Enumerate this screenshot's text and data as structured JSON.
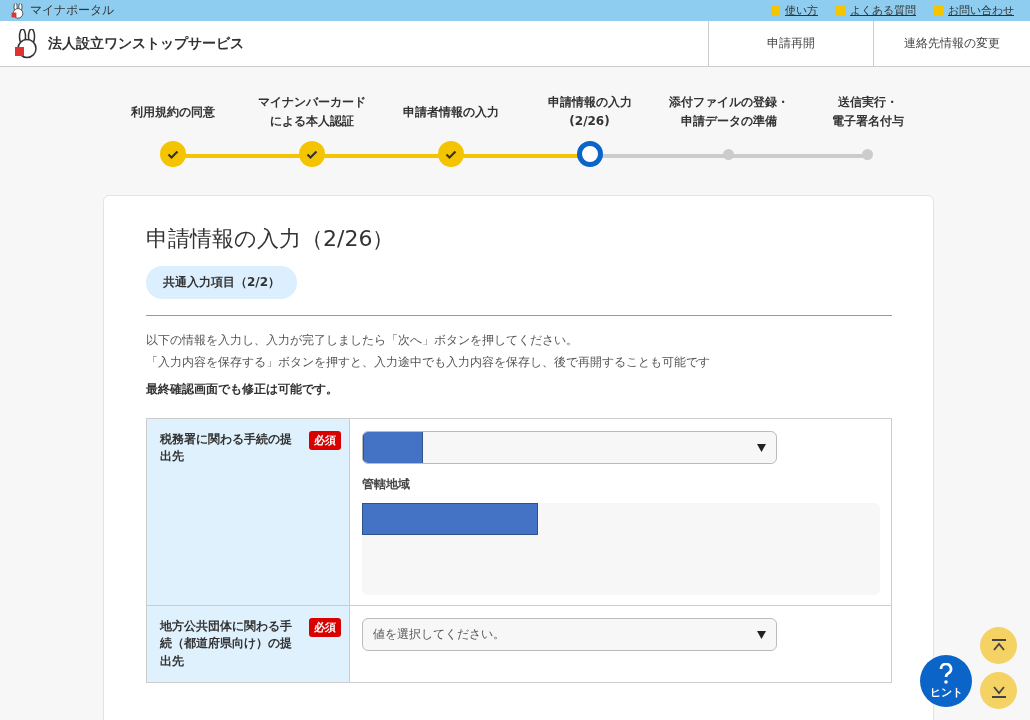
{
  "top_bar": {
    "portal": "マイナポータル",
    "links": [
      "使い方",
      "よくある質問",
      "お問い合わせ"
    ]
  },
  "header": {
    "title": "法人設立ワンストップサービス",
    "nav": [
      "申請再開",
      "連絡先情報の変更"
    ]
  },
  "steps": [
    {
      "lines": [
        "利用規約の同意"
      ],
      "kind": "done"
    },
    {
      "lines": [
        "マイナンバーカード",
        "による本人認証"
      ],
      "kind": "done"
    },
    {
      "lines": [
        "申請者情報の入力"
      ],
      "kind": "done"
    },
    {
      "lines": [
        "申請情報の入力",
        "(2/26)"
      ],
      "kind": "current"
    },
    {
      "lines": [
        "添付ファイルの登録・",
        "申請データの準備"
      ],
      "kind": "todo"
    },
    {
      "lines": [
        "送信実行・",
        "電子署名付与"
      ],
      "kind": "todo"
    }
  ],
  "form": {
    "title": "申請情報の入力（2/26）",
    "section": "共通入力項目（2/2）",
    "intro": [
      "以下の情報を入力し、入力が完了しましたら「次へ」ボタンを押してください。",
      "「入力内容を保存する」ボタンを押すと、入力途中でも入力内容を保存し、後で再開することも可能です"
    ],
    "note": "最終確認画面でも修正は可能です。",
    "rows": [
      {
        "label": "税務署に関わる手続の提出先",
        "badge": "必須",
        "select": {
          "redacted": true
        },
        "sub_label": "管轄地域",
        "sub_redacted": true
      },
      {
        "label": "地方公共団体に関わる手続（都道府県向け）の提出先",
        "badge": "必須",
        "select": {
          "redacted": false,
          "placeholder": "値を選択してください。"
        }
      }
    ]
  },
  "hint": {
    "label": "ヒント"
  }
}
